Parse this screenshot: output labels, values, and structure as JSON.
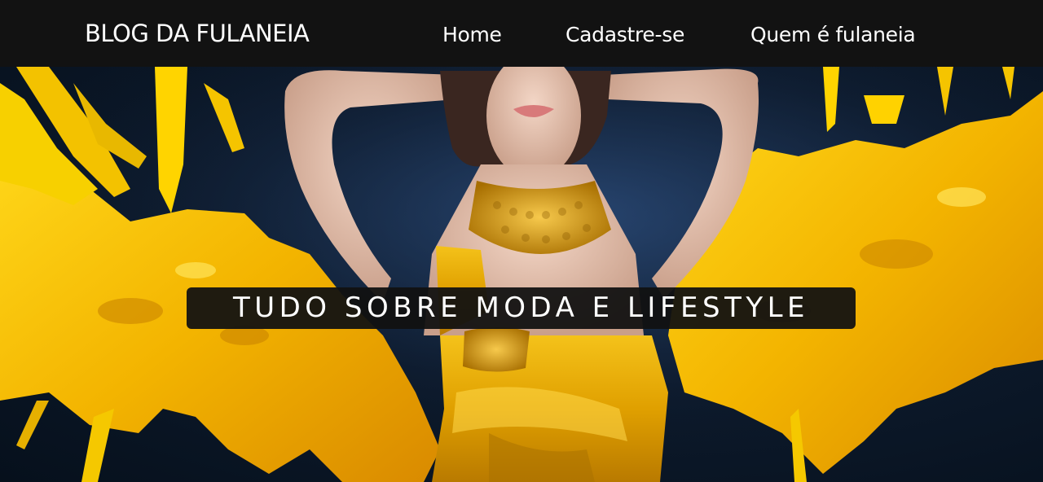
{
  "header": {
    "brand": "BLOG DA FULANEIA",
    "nav": [
      {
        "label": "Home"
      },
      {
        "label": "Cadastre-se"
      },
      {
        "label": "Quem é fulaneia"
      }
    ]
  },
  "hero": {
    "tagline": "TUDO SOBRE MODA E LIFESTYLE",
    "image_alt": "Woman in a golden dress with beaded necklace surrounded by yellow paint splashes"
  },
  "colors": {
    "header_bg": "#121212",
    "paint_yellow": "#f5c400",
    "paint_orange": "#f0a000",
    "background_navy": "#0d1a2c"
  }
}
